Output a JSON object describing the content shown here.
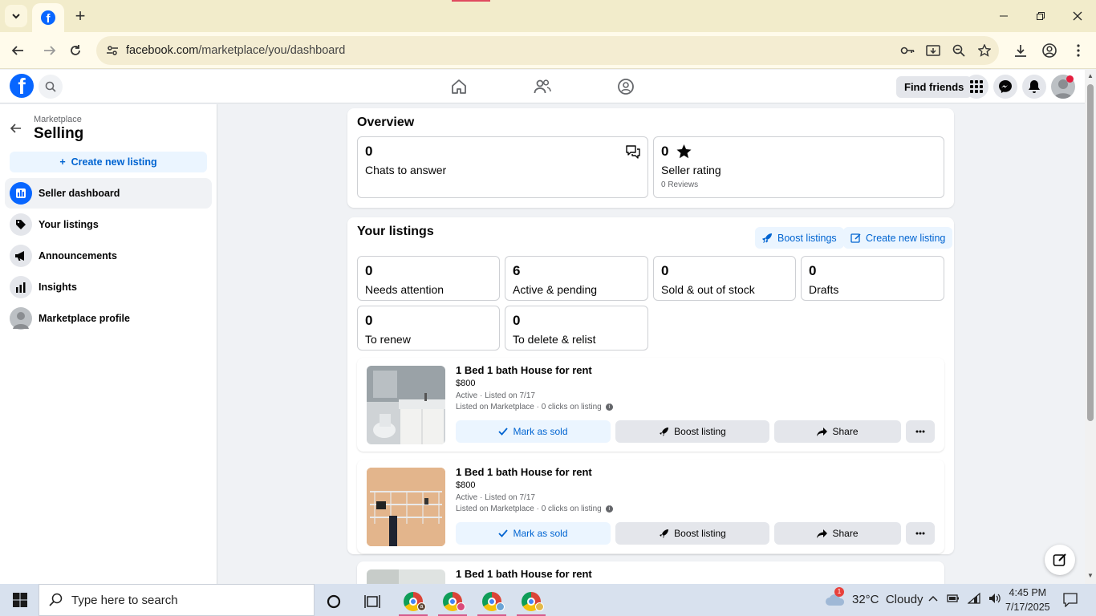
{
  "browser": {
    "url_domain": "facebook.com",
    "url_path": "/marketplace/you/dashboard"
  },
  "fb_header": {
    "find_friends": "Find friends"
  },
  "sidebar": {
    "breadcrumb": "Marketplace",
    "title": "Selling",
    "create_button": "Create new listing",
    "items": [
      {
        "label": "Seller dashboard",
        "icon": "dashboard-icon"
      },
      {
        "label": "Your listings",
        "icon": "tag-icon"
      },
      {
        "label": "Announcements",
        "icon": "megaphone-icon"
      },
      {
        "label": "Insights",
        "icon": "bar-chart-icon"
      },
      {
        "label": "Marketplace profile",
        "icon": "profile-icon"
      }
    ]
  },
  "overview": {
    "title": "Overview",
    "chats": {
      "value": "0",
      "label": "Chats to answer"
    },
    "rating": {
      "value": "0",
      "label": "Seller rating",
      "reviews": "0 Reviews"
    }
  },
  "your_listings": {
    "title": "Your listings",
    "boost_button": "Boost listings",
    "create_button": "Create new listing",
    "stats": [
      {
        "value": "0",
        "label": "Needs attention"
      },
      {
        "value": "6",
        "label": "Active & pending"
      },
      {
        "value": "0",
        "label": "Sold & out of stock"
      },
      {
        "value": "0",
        "label": "Drafts"
      },
      {
        "value": "0",
        "label": "To renew"
      },
      {
        "value": "0",
        "label": "To delete & relist"
      }
    ]
  },
  "listings": [
    {
      "title": "1 Bed 1 bath House for rent",
      "price": "$800",
      "status": "Active · Listed on 7/17",
      "clicks": "Listed on Marketplace · 0 clicks on listing",
      "mark_sold": "Mark as sold",
      "boost": "Boost listing",
      "share": "Share"
    },
    {
      "title": "1 Bed 1 bath House for rent",
      "price": "$800",
      "status": "Active · Listed on 7/17",
      "clicks": "Listed on Marketplace · 0 clicks on listing",
      "mark_sold": "Mark as sold",
      "boost": "Boost listing",
      "share": "Share"
    },
    {
      "title": "1 Bed 1 bath House for rent"
    }
  ],
  "taskbar": {
    "search_placeholder": "Type here to search",
    "weather": "32°C  Cloudy",
    "weather_badge": "1",
    "time": "4:45 PM",
    "date": "7/17/2025"
  },
  "colors": {
    "fb_blue": "#0866ff",
    "link_blue": "#0064d1",
    "light_blue_bg": "#ebf5ff"
  }
}
